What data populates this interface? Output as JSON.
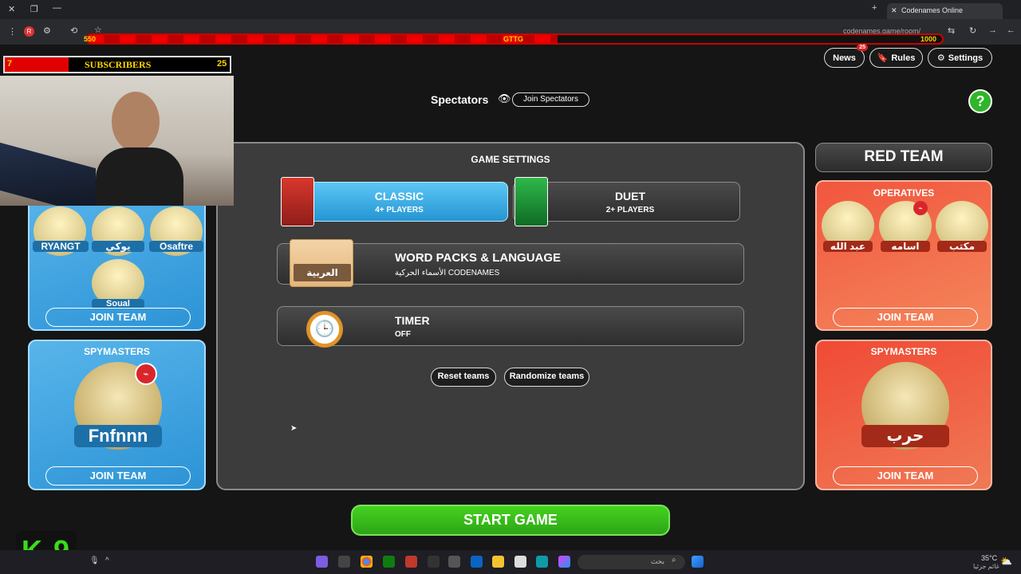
{
  "browser": {
    "tab_title": "Codenames Online",
    "url": "codenames.game/room/",
    "progress_left": "550",
    "progress_mid": "GTTG",
    "progress_right": "1000",
    "progress_fill": 0.55
  },
  "header": {
    "news_label": "News",
    "news_badge": "25",
    "rules_label": "Rules",
    "settings_label": "Settings",
    "spectators_label": "Spectators",
    "join_spectators_label": "Join Spectators",
    "help_symbol": "?"
  },
  "overlay": {
    "subs_count": "7",
    "subs_label": "SUBSCRIBERS",
    "subs_goal": "25",
    "logo_text": "K 9"
  },
  "blue_team": {
    "operatives": [
      "RYANGT",
      "يوكي",
      "Osaftre",
      "Soual"
    ],
    "join_team_label": "JOIN TEAM",
    "spymasters_title": "SPYMASTERS",
    "spymaster_name": "Fnfnnn",
    "spymaster_join_label": "JOIN TEAM"
  },
  "red_team": {
    "title": "RED TEAM",
    "operatives_title": "OPERATIVES",
    "operatives": [
      "عبد الله",
      "اسامه",
      "مكتب"
    ],
    "join_team_label": "JOIN TEAM",
    "spymasters_title": "SPYMASTERS",
    "spymaster_name": "حرب",
    "spymaster_join_label": "JOIN TEAM"
  },
  "settings": {
    "title": "GAME SETTINGS",
    "classic_label": "CLASSIC",
    "classic_sub": "4+ PLAYERS",
    "duet_label": "DUET",
    "duet_sub": "2+ PLAYERS",
    "wordpack_title": "WORD PACKS & LANGUAGE",
    "wordpack_sub": "الأسماء الحركية CODENAMES",
    "wordpack_box_label": "العربية",
    "timer_title": "TIMER",
    "timer_sub": "OFF",
    "reset_label": "Reset teams",
    "randomize_label": "Randomize teams",
    "start_label": "START GAME"
  },
  "taskbar": {
    "search_placeholder": "بحث",
    "weather_temp": "35°C",
    "weather_desc": "غائم جزئيا"
  },
  "colors": {
    "blue": "#2c93d6",
    "red": "#f1563e",
    "start_green": "#3cc21a",
    "help_green": "#2fb52a"
  }
}
